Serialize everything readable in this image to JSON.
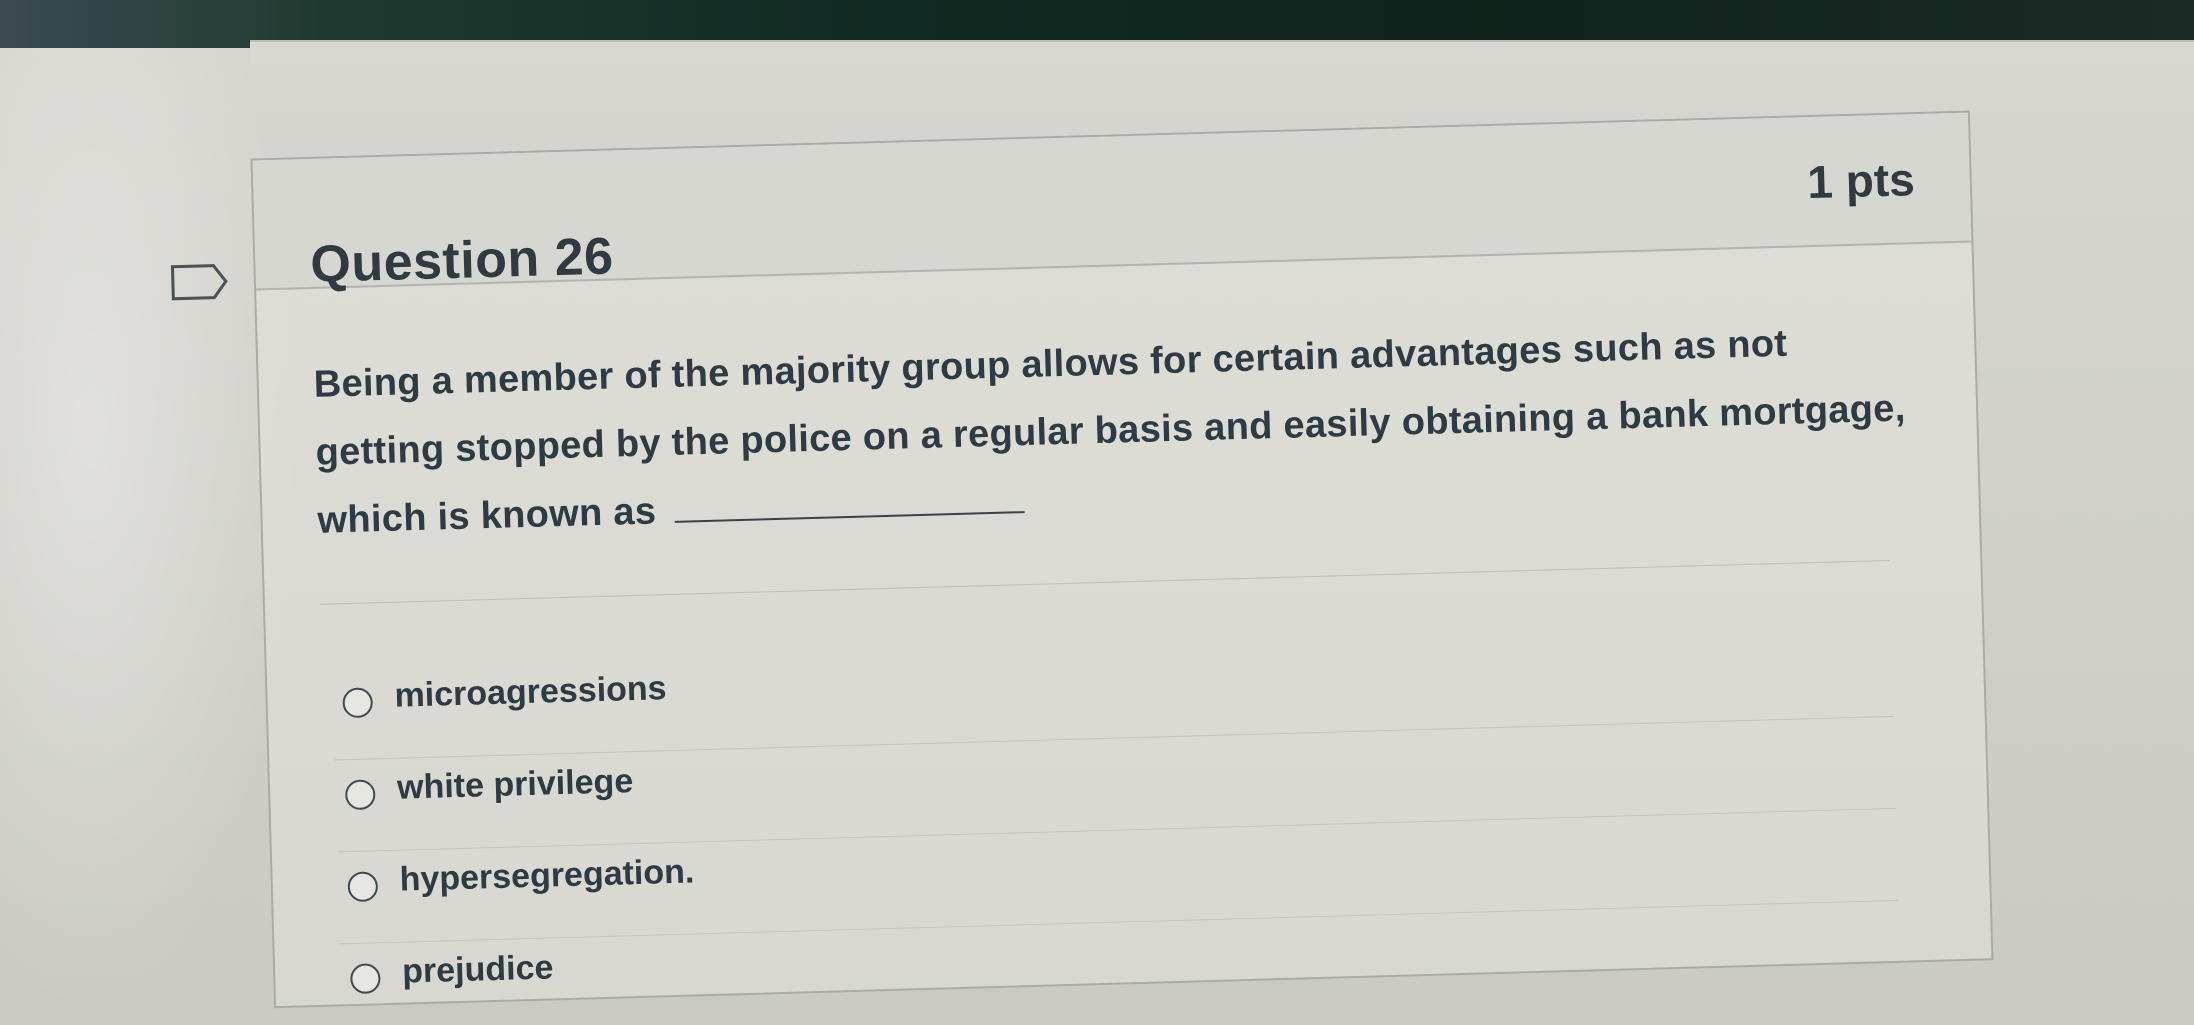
{
  "question": {
    "title": "Question 26",
    "points": "1 pts",
    "text": "Being a member of the majority group allows for certain advantages such as not getting stopped by the police on a regular basis and easily obtaining a bank mortgage, which is known as",
    "answers": [
      {
        "label": "microagressions"
      },
      {
        "label": "white privilege"
      },
      {
        "label": "hypersegregation."
      },
      {
        "label": "prejudice"
      }
    ]
  },
  "icons": {
    "bookmark": "bookmark-flag-icon",
    "radio": "radio-button-icon"
  },
  "colors": {
    "text": "#2d3b45",
    "border": "#a9aba7",
    "header_bg": "#d6d6d0"
  }
}
